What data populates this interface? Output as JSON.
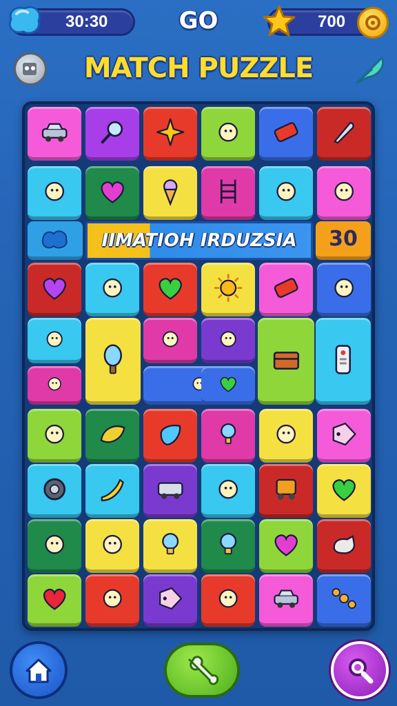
{
  "hud": {
    "timer": "30:30",
    "go_label": "GO",
    "score": "700"
  },
  "header": {
    "title": "MATCH PUZZLE"
  },
  "banner": {
    "text": "IIMATIOH IRDUZSIA",
    "counter": "30"
  },
  "colors": {
    "pink": "#f55bd8",
    "purple": "#a83ee8",
    "red": "#e83a2a",
    "lime": "#8fd63a",
    "blue": "#3a6ee8",
    "darkred": "#c92a28",
    "cyan": "#38c8f0",
    "green": "#1f8a4a",
    "yellow": "#f5e042",
    "magenta": "#e03aa8",
    "violet": "#7a3ad0",
    "orange": "#f5a01a"
  },
  "tiles": [
    {
      "icon": "car-icon",
      "color": "pink"
    },
    {
      "icon": "magnifier-icon",
      "color": "purple"
    },
    {
      "icon": "star-icon",
      "color": "red"
    },
    {
      "icon": "shrimp-icon",
      "color": "lime"
    },
    {
      "icon": "eraser-icon",
      "color": "blue"
    },
    {
      "icon": "knife-icon",
      "color": "darkred"
    },
    {
      "icon": "robot-toy-icon",
      "color": "cyan"
    },
    {
      "icon": "heart-icon",
      "color": "green"
    },
    {
      "icon": "ice-cream-icon",
      "color": "yellow"
    },
    {
      "icon": "ladder-icon",
      "color": "magenta"
    },
    {
      "icon": "drill-icon",
      "color": "cyan"
    },
    {
      "icon": "ornament-icon",
      "color": "pink"
    },
    {
      "icon": "heart-icon",
      "color": "darkred"
    },
    {
      "icon": "bottle-icon",
      "color": "cyan"
    },
    {
      "icon": "heart-icon",
      "color": "red"
    },
    {
      "icon": "sun-icon",
      "color": "yellow"
    },
    {
      "icon": "eraser-icon",
      "color": "pink"
    },
    {
      "icon": "tape-icon",
      "color": "blue"
    },
    {
      "icon": "bone-toy-icon",
      "color": "cyan"
    },
    {
      "icon": "balloon-icon",
      "color": "yellow"
    },
    {
      "icon": "bead-icon",
      "color": "magenta"
    },
    {
      "icon": "gear-box-icon",
      "color": "violet"
    },
    {
      "icon": "chest-icon",
      "color": "lime"
    },
    {
      "icon": "remote-icon",
      "color": "cyan"
    },
    {
      "icon": "scissors-icon",
      "color": "magenta"
    },
    {
      "icon": "carrot-icon",
      "color": "blue"
    },
    {
      "icon": "heart-icon",
      "color": "blue"
    },
    {
      "icon": "lemon-face-icon",
      "color": "lime"
    },
    {
      "icon": "leaf-icon",
      "color": "green"
    },
    {
      "icon": "gem-icon",
      "color": "red"
    },
    {
      "icon": "lamp-icon",
      "color": "magenta"
    },
    {
      "icon": "pencil-icon",
      "color": "yellow"
    },
    {
      "icon": "tag-icon",
      "color": "pink"
    },
    {
      "icon": "tire-icon",
      "color": "cyan"
    },
    {
      "icon": "banana-icon",
      "color": "cyan"
    },
    {
      "icon": "van-icon",
      "color": "violet"
    },
    {
      "icon": "ping-pong-icon",
      "color": "cyan"
    },
    {
      "icon": "cart-icon",
      "color": "darkred"
    },
    {
      "icon": "heart-icon",
      "color": "yellow"
    },
    {
      "icon": "cheese-icon",
      "color": "green"
    },
    {
      "icon": "shoe-icon",
      "color": "yellow"
    },
    {
      "icon": "bulb-icon",
      "color": "yellow"
    },
    {
      "icon": "bulb-icon",
      "color": "green"
    },
    {
      "icon": "heart-icon",
      "color": "lime"
    },
    {
      "icon": "dog-icon",
      "color": "darkred"
    },
    {
      "icon": "heart-icon",
      "color": "lime"
    },
    {
      "icon": "maraca-icon",
      "color": "red"
    },
    {
      "icon": "tag-icon",
      "color": "violet"
    },
    {
      "icon": "chick-icon",
      "color": "red"
    },
    {
      "icon": "car-icon",
      "color": "pink"
    },
    {
      "icon": "bone-icon",
      "color": "blue"
    }
  ],
  "nav": {
    "home_icon": "home-icon",
    "center_icon": "wrench-icon",
    "search_icon": "search-icon"
  }
}
